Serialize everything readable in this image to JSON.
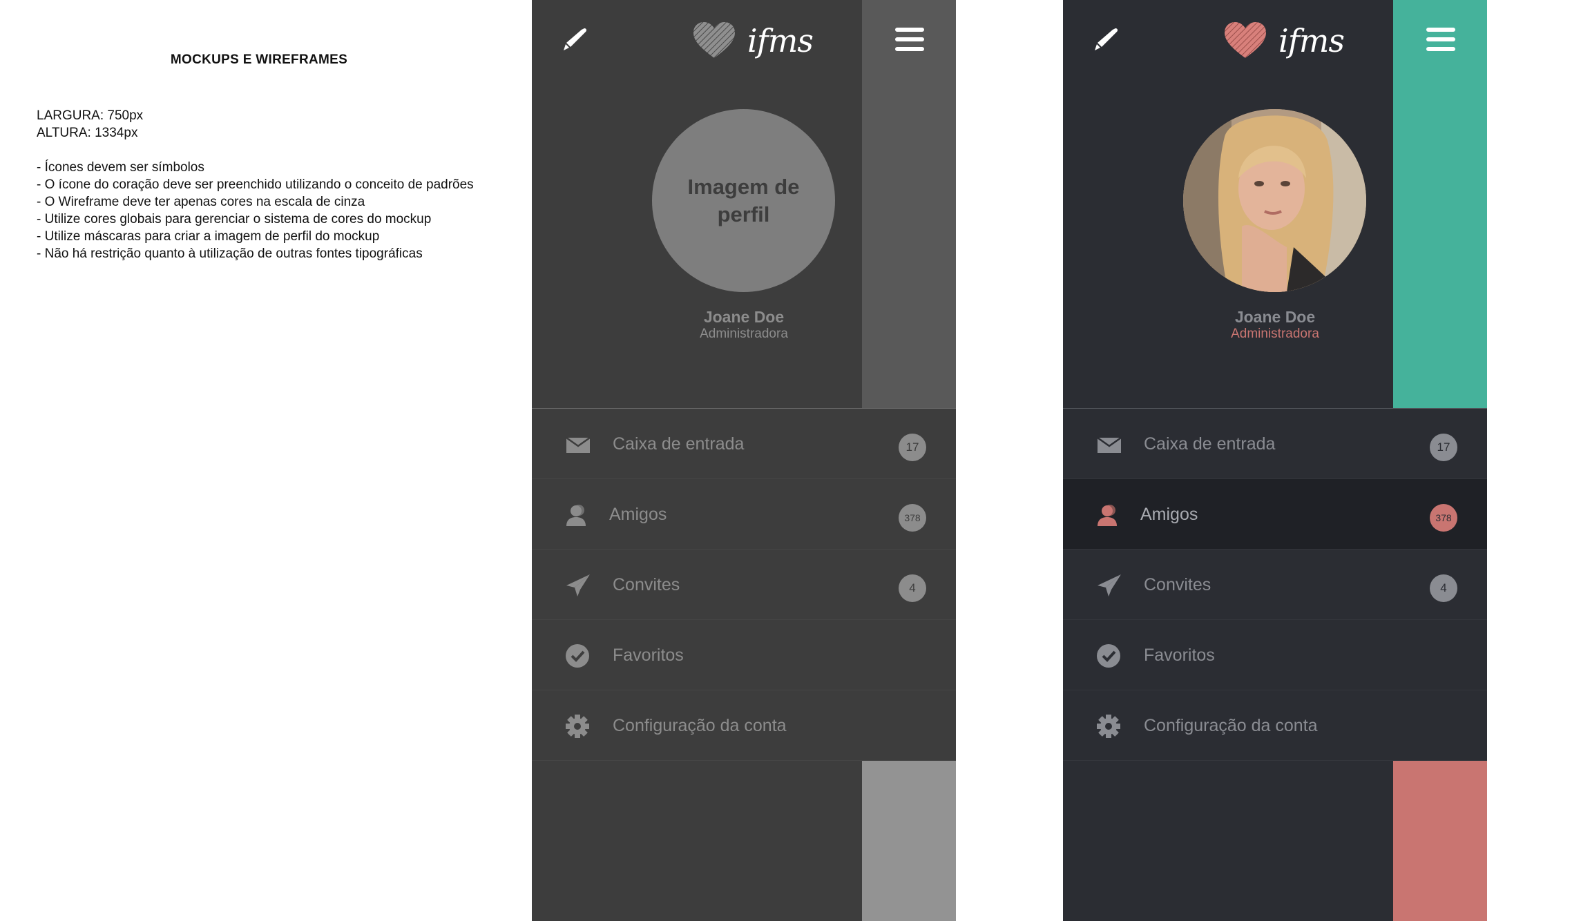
{
  "notes": {
    "title": "MOCKUPS E WIREFRAMES",
    "width_label": "LARGURA: 750px",
    "height_label": "ALTURA: 1334px",
    "items": [
      "- Ícones devem ser símbolos",
      "- O ícone do coração deve ser preenchido utilizando o conceito de padrões",
      "- O Wireframe deve ter apenas cores na escala de cinza",
      "- Utilize cores globais para gerenciar o sistema de cores do mockup",
      "- Utilize máscaras para criar a imagem de perfil do mockup",
      "- Não há restrição quanto à utilização de outras fontes tipográficas"
    ]
  },
  "brand": {
    "logo_text": "ifms"
  },
  "wireframe": {
    "avatar_placeholder": "Imagem de perfil",
    "user_name": "Joane Doe",
    "user_role": "Administradora"
  },
  "mockup": {
    "user_name": "Joane Doe",
    "user_role": "Administradora"
  },
  "menu": [
    {
      "label": "Caixa de entrada",
      "badge": "17",
      "icon": "envelope-icon"
    },
    {
      "label": "Amigos",
      "badge": "378",
      "icon": "user-icon"
    },
    {
      "label": "Convites",
      "badge": "4",
      "icon": "paper-plane-icon"
    },
    {
      "label": "Favoritos",
      "badge": "",
      "icon": "check-circle-icon"
    },
    {
      "label": "Configuração da conta",
      "badge": "",
      "icon": "gear-icon"
    }
  ],
  "colors": {
    "wire_bg": "#3d3d3d",
    "mock_bg": "#2b2d33",
    "mock_active_bg": "#1f2126",
    "accent_teal": "#45b29b",
    "accent_coral": "#c97571"
  }
}
